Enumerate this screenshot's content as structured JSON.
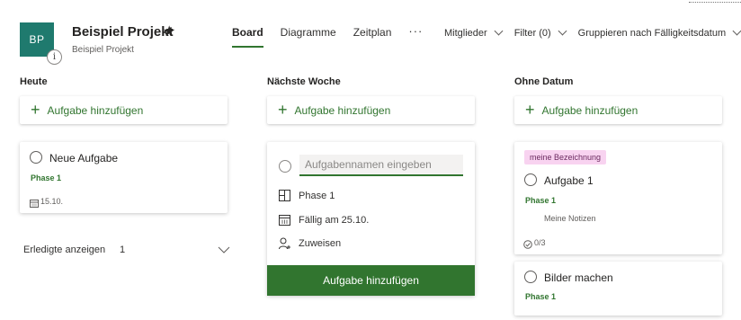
{
  "header": {
    "avatar_initials": "BP",
    "title": "Beispiel Projekt",
    "subtitle": "Beispiel Projekt",
    "tabs": [
      {
        "label": "Board"
      },
      {
        "label": "Diagramme"
      },
      {
        "label": "Zeitplan"
      }
    ],
    "more": "···",
    "filters": [
      {
        "label": "Mitglieder"
      },
      {
        "label": "Filter (0)"
      },
      {
        "label": "Gruppieren nach Fälligkeitsdatum"
      }
    ]
  },
  "columns": [
    {
      "title": "Heute",
      "add_label": "Aufgabe hinzufügen",
      "tasks": [
        {
          "title": "Neue Aufgabe",
          "phase": "Phase 1",
          "date": "15.10."
        }
      ],
      "completed_label": "Erledigte anzeigen",
      "completed_count": "1"
    },
    {
      "title": "Nächste Woche",
      "add_label": "Aufgabe hinzufügen",
      "editor": {
        "placeholder": "Aufgabennamen eingeben",
        "bucket": "Phase 1",
        "due": "Fällig am 25.10.",
        "assign": "Zuweisen",
        "submit": "Aufgabe hinzufügen"
      }
    },
    {
      "title": "Ohne Datum",
      "add_label": "Aufgabe hinzufügen",
      "tasks": [
        {
          "label": "meine Bezeichnung",
          "title": "Aufgabe 1",
          "phase": "Phase 1",
          "notes": "Meine Notizen",
          "checklist": "0/3"
        },
        {
          "title": "Bilder machen",
          "phase": "Phase 1"
        }
      ]
    }
  ],
  "colors": {
    "accent": "#31752f",
    "avatar": "#1f7a6e",
    "label_bg": "#f8d3f0"
  }
}
